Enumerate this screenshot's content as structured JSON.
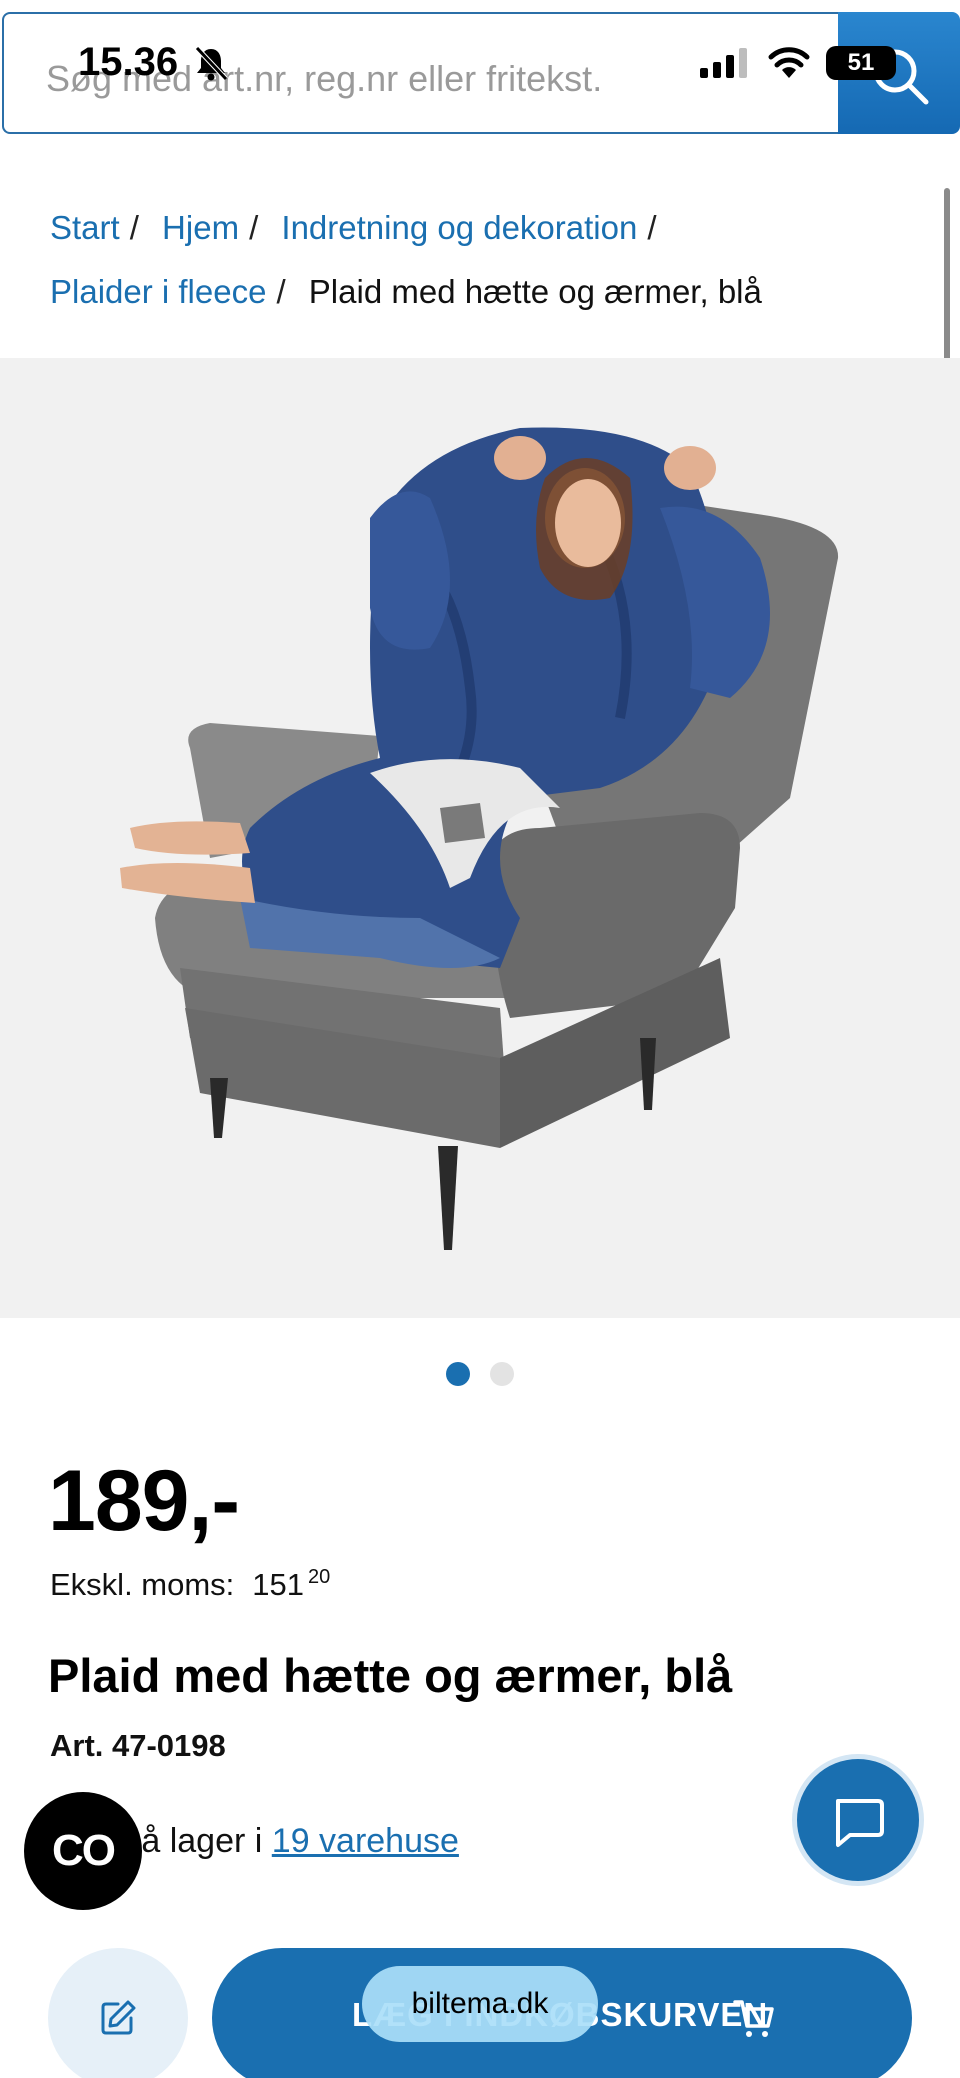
{
  "status_bar": {
    "time": "15.36",
    "battery": "51"
  },
  "search": {
    "placeholder": "Søg med art.nr, reg.nr eller fritekst.",
    "icons": {
      "search": "search-icon"
    }
  },
  "breadcrumb": {
    "items": [
      "Start",
      "Hjem",
      "Indretning og dekoration",
      "Plaider i fleece"
    ],
    "separator": "/",
    "current": "Plaid med hætte og ærmer, blå"
  },
  "product": {
    "price": "189,-",
    "excl_vat_label": "Ekskl. moms:",
    "excl_vat_integer": "151",
    "excl_vat_decimal": "20",
    "title": "Plaid med hætte og ærmer, blå",
    "article_number": "Art. 47-0198",
    "stock_text": "s på lager i",
    "stock_link": "19 varehuse",
    "image_count": 2,
    "active_image": 1
  },
  "actions": {
    "add_to_cart_label": "LÆG I INDKØBSKURVEN",
    "co_badge": "CO",
    "url_pill": "biltema.dk"
  },
  "colors": {
    "brand_blue": "#1a6fb0",
    "search_blue": "#2a86cf",
    "chair_grey": "#6f6f6f",
    "blanket_blue": "#2f4e8a"
  }
}
